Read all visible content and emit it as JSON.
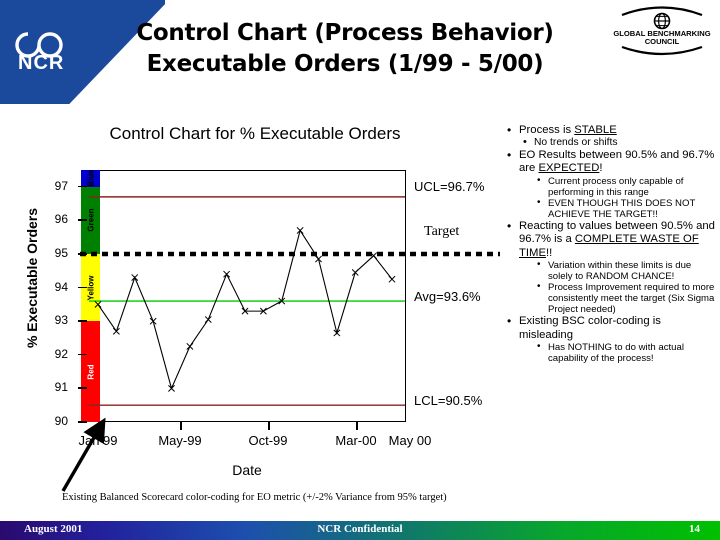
{
  "header": {
    "logo_text": "NCR",
    "title_line1": "Control Chart (Process Behavior)",
    "title_line2": "Executable Orders (1/99 - 5/00)",
    "badge_line1": "GLOBAL BENCHMARKING",
    "badge_line2": "COUNCIL",
    "brand_blue": "#1b4a9c"
  },
  "chart_data": {
    "type": "line",
    "title": "Control Chart for % Executable Orders",
    "xlabel": "Date",
    "ylabel": "% Executable Orders",
    "ylim": [
      90,
      97.5
    ],
    "yticks": [
      97,
      96,
      95,
      94,
      93,
      92,
      91,
      90
    ],
    "xticks": [
      "Jan 99",
      "May-99",
      "Oct-99",
      "Mar-00",
      "May 00"
    ],
    "grid": false,
    "legend": "none",
    "series": [
      {
        "name": "% Executable Orders",
        "marker": "x",
        "color": "#000000",
        "values": [
          93.5,
          92.7,
          94.3,
          93.0,
          91.0,
          92.25,
          93.05,
          94.4,
          93.3,
          93.3,
          93.6,
          95.7,
          94.85,
          92.65,
          94.45,
          94.95,
          94.25
        ]
      }
    ],
    "reference_lines": [
      {
        "name": "UCL",
        "value": 96.7,
        "label": "UCL=96.7%",
        "color": "#8b2222",
        "style": "solid"
      },
      {
        "name": "Target",
        "value": 95.0,
        "label": "Target",
        "color": "#000000",
        "style": "dotted"
      },
      {
        "name": "Avg",
        "value": 93.6,
        "label": "Avg=93.6%",
        "color": "#00cc00",
        "style": "solid"
      },
      {
        "name": "LCL",
        "value": 90.5,
        "label": "LCL=90.5%",
        "color": "#8b2222",
        "style": "solid"
      }
    ],
    "color_bands": [
      {
        "label": "Blue",
        "color": "#0000cc",
        "text_color": "#000000",
        "from": 97.0,
        "to": 97.5
      },
      {
        "label": "Green",
        "color": "#008000",
        "text_color": "#000000",
        "from": 95.0,
        "to": 97.0
      },
      {
        "label": "Yellow",
        "color": "#ffff00",
        "text_color": "#000000",
        "from": 93.0,
        "to": 95.0
      },
      {
        "label": "Red",
        "color": "#ff0000",
        "text_color": "#ffffff",
        "from": 90.0,
        "to": 93.0
      }
    ],
    "caption": "Existing Balanced Scorecard color-coding for EO metric (+/-2% Variance from 95% target)"
  },
  "bullets": [
    {
      "level": 1,
      "text": "Process is ",
      "underline": "STABLE",
      "tail": ""
    },
    {
      "level": 2,
      "text": "No trends or shifts"
    },
    {
      "level": 1,
      "text": "EO Results between 90.5% and 96.7% are ",
      "underline": "EXPECTED",
      "tail": "!"
    },
    {
      "level": 3,
      "text": "Current process only capable of performing in this range"
    },
    {
      "level": 3,
      "text": "EVEN THOUGH THIS DOES NOT ACHIEVE THE TARGET!!"
    },
    {
      "level": 1,
      "text": "Reacting to values between 90.5% and 96.7% is a ",
      "underline": "COMPLETE WASTE OF TIME",
      "tail": "!!"
    },
    {
      "level": 3,
      "text": "Variation within these limits is due solely to RANDOM CHANCE!"
    },
    {
      "level": 3,
      "text": "Process Improvement required to more consistently meet the target (Six Sigma Project needed)"
    },
    {
      "level": 1,
      "text": "Existing BSC color-coding is misleading",
      "underline": "",
      "tail": ""
    },
    {
      "level": 3,
      "text": "Has NOTHING to do with actual capability of the process!"
    }
  ],
  "footer": {
    "date": "August 2001",
    "center": "NCR Confidential",
    "page": "14"
  }
}
